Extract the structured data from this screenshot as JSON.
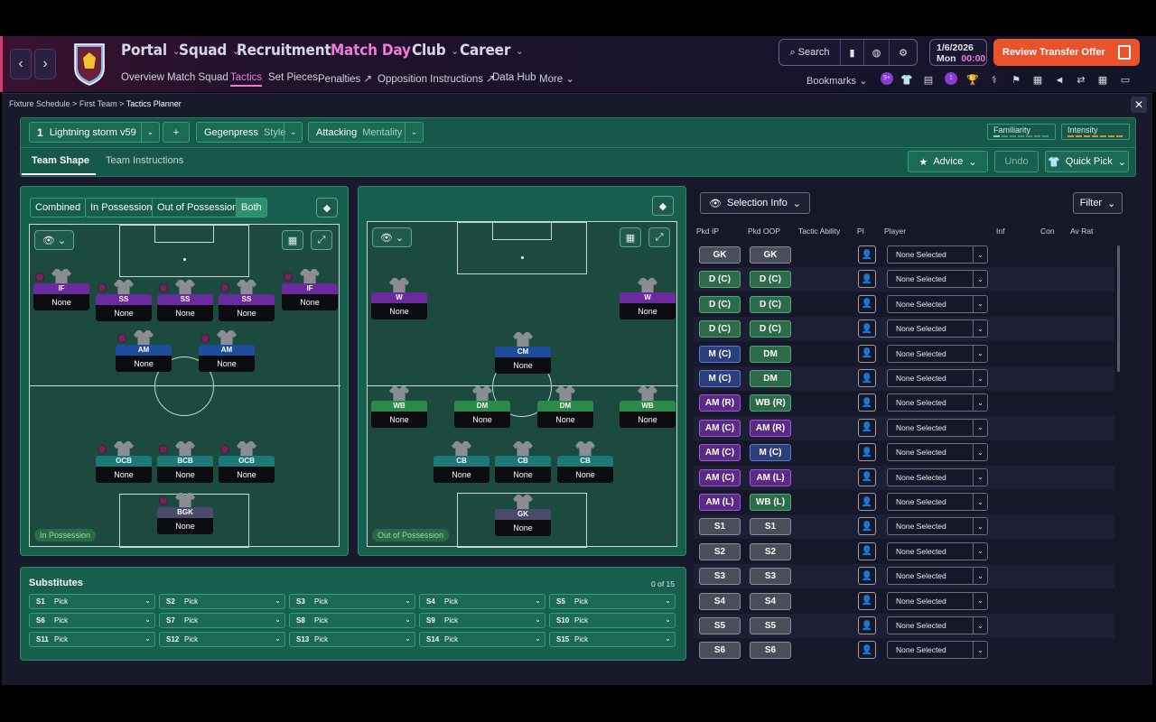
{
  "header": {
    "nav": [
      "Portal",
      "Squad",
      "Recruitment",
      "Match Day",
      "Club",
      "Career"
    ],
    "active_nav": "Match Day",
    "subnav": [
      "Overview",
      "Match Squad",
      "Tactics",
      "Set Pieces",
      "Penalties",
      "Opposition Instructions",
      "Data Hub",
      "More"
    ],
    "active_subnav": "Tactics",
    "search_label": "Search",
    "date": "1/6/2026",
    "day": "Mon",
    "time": "00:00",
    "review_label": "Review Transfer Offer",
    "bookmarks_label": "Bookmarks",
    "badge_count_1": "9+",
    "badge_count_2": "1"
  },
  "breadcrumb": [
    "Fixture Schedule",
    "First Team",
    "Tactics Planner"
  ],
  "tactic": {
    "slot_number": "1",
    "name": "Lightning storm v59",
    "add_label": "+",
    "style_value": "Gegenpress",
    "style_label": "Style",
    "mentality_value": "Attacking",
    "mentality_label": "Mentality",
    "familiarity_label": "Familiarity",
    "intensity_label": "Intensity",
    "tabs": [
      "Team Shape",
      "Team Instructions"
    ],
    "advice_label": "Advice",
    "undo_label": "Undo",
    "quickpick_label": "Quick Pick"
  },
  "view_filters": [
    "Combined",
    "In Possession",
    "Out of Possession",
    "Both"
  ],
  "active_filter": "Both",
  "in_possession_tag": "In Possession",
  "out_possession_tag": "Out of Possession",
  "ip_players": [
    {
      "pos": "IF",
      "name": "None",
      "color": "purple"
    },
    {
      "pos": "SS",
      "name": "None",
      "color": "purple"
    },
    {
      "pos": "SS",
      "name": "None",
      "color": "purple"
    },
    {
      "pos": "SS",
      "name": "None",
      "color": "purple"
    },
    {
      "pos": "IF",
      "name": "None",
      "color": "purple"
    },
    {
      "pos": "AM",
      "name": "None",
      "color": "blue"
    },
    {
      "pos": "AM",
      "name": "None",
      "color": "blue"
    },
    {
      "pos": "OCB",
      "name": "None",
      "color": "teal"
    },
    {
      "pos": "BCB",
      "name": "None",
      "color": "teal"
    },
    {
      "pos": "OCB",
      "name": "None",
      "color": "teal"
    },
    {
      "pos": "BGK",
      "name": "None",
      "color": "gk"
    }
  ],
  "oop_players": [
    {
      "pos": "W",
      "name": "None",
      "color": "purple"
    },
    {
      "pos": "W",
      "name": "None",
      "color": "purple"
    },
    {
      "pos": "CM",
      "name": "None",
      "color": "blue"
    },
    {
      "pos": "WB",
      "name": "None",
      "color": "green"
    },
    {
      "pos": "DM",
      "name": "None",
      "color": "green"
    },
    {
      "pos": "DM",
      "name": "None",
      "color": "green"
    },
    {
      "pos": "WB",
      "name": "None",
      "color": "green"
    },
    {
      "pos": "CB",
      "name": "None",
      "color": "teal"
    },
    {
      "pos": "CB",
      "name": "None",
      "color": "teal"
    },
    {
      "pos": "CB",
      "name": "None",
      "color": "teal"
    },
    {
      "pos": "GK",
      "name": "None",
      "color": "gk"
    }
  ],
  "substitutes": {
    "title": "Substitutes",
    "count": "0 of 15",
    "slots": [
      "S1",
      "S2",
      "S3",
      "S4",
      "S5",
      "S6",
      "S7",
      "S8",
      "S9",
      "S10",
      "S11",
      "S12",
      "S13",
      "S14",
      "S15"
    ],
    "pick_label": "Pick"
  },
  "selection": {
    "info_label": "Selection Info",
    "filter_label": "Filter",
    "columns": [
      "Pkd IP",
      "Pkd OOP",
      "Tactic Ability",
      "PI",
      "Player",
      "Inf",
      "Con",
      "Av Rat"
    ],
    "none_selected": "None Selected",
    "rows": [
      {
        "ip": "GK",
        "oop": "GK",
        "ipc": "gray",
        "oopc": "gray"
      },
      {
        "ip": "D (C)",
        "oop": "D (C)",
        "ipc": "green",
        "oopc": "green"
      },
      {
        "ip": "D (C)",
        "oop": "D (C)",
        "ipc": "green",
        "oopc": "green"
      },
      {
        "ip": "D (C)",
        "oop": "D (C)",
        "ipc": "green",
        "oopc": "green"
      },
      {
        "ip": "M (C)",
        "oop": "DM",
        "ipc": "blue",
        "oopc": "green"
      },
      {
        "ip": "M (C)",
        "oop": "DM",
        "ipc": "blue",
        "oopc": "green"
      },
      {
        "ip": "AM (R)",
        "oop": "WB (R)",
        "ipc": "purple",
        "oopc": "green"
      },
      {
        "ip": "AM (C)",
        "oop": "AM (R)",
        "ipc": "purple",
        "oopc": "purple"
      },
      {
        "ip": "AM (C)",
        "oop": "M (C)",
        "ipc": "purple",
        "oopc": "blue"
      },
      {
        "ip": "AM (C)",
        "oop": "AM (L)",
        "ipc": "purple",
        "oopc": "purple"
      },
      {
        "ip": "AM (L)",
        "oop": "WB (L)",
        "ipc": "purple",
        "oopc": "green"
      },
      {
        "ip": "S1",
        "oop": "S1",
        "ipc": "gray",
        "oopc": "gray"
      },
      {
        "ip": "S2",
        "oop": "S2",
        "ipc": "gray",
        "oopc": "gray"
      },
      {
        "ip": "S3",
        "oop": "S3",
        "ipc": "gray",
        "oopc": "gray"
      },
      {
        "ip": "S4",
        "oop": "S4",
        "ipc": "gray",
        "oopc": "gray"
      },
      {
        "ip": "S5",
        "oop": "S5",
        "ipc": "gray",
        "oopc": "gray"
      },
      {
        "ip": "S6",
        "oop": "S6",
        "ipc": "gray",
        "oopc": "gray"
      }
    ]
  }
}
